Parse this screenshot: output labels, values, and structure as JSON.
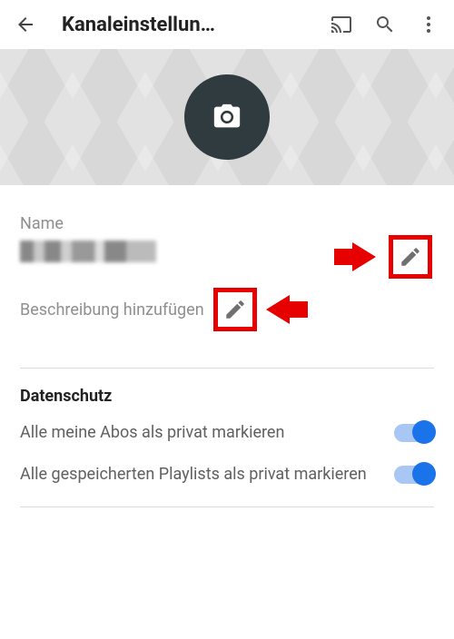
{
  "topbar": {
    "title": "Kanaleinstellun…"
  },
  "fields": {
    "name_label": "Name",
    "description_label": "Beschreibung hinzufügen"
  },
  "sections": {
    "privacy_title": "Datenschutz"
  },
  "settings": {
    "subs_private_label": "Alle meine Abos als privat markieren",
    "playlists_private_label": "Alle gespeicherten Playlists als privat markieren",
    "subs_private_on": true,
    "playlists_private_on": true
  }
}
